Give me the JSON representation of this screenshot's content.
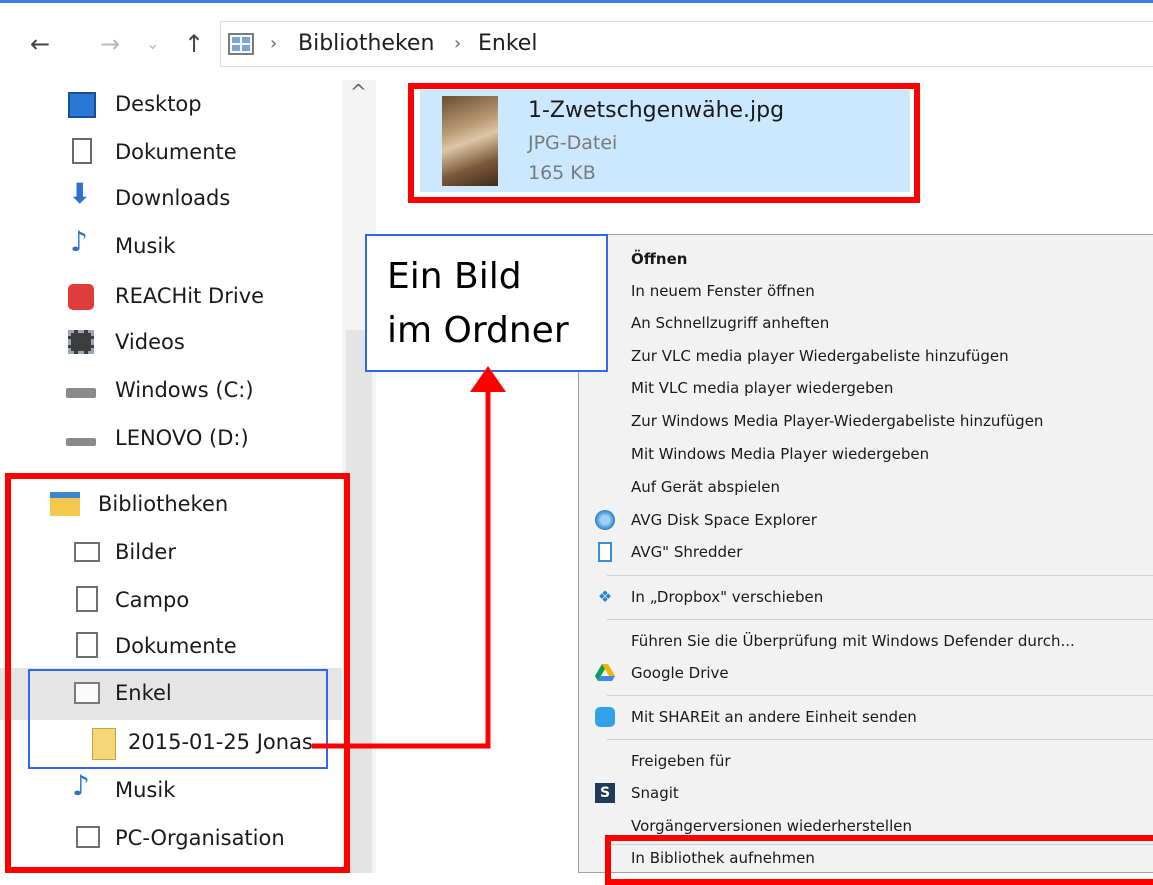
{
  "breadcrumb": {
    "items": [
      "Bibliotheken",
      "Enkel"
    ]
  },
  "nav": {
    "items": [
      {
        "label": "Desktop",
        "icon": "desktop-icon"
      },
      {
        "label": "Dokumente",
        "icon": "document-icon"
      },
      {
        "label": "Downloads",
        "icon": "download-arrow-icon"
      },
      {
        "label": "Musik",
        "icon": "music-note-icon"
      },
      {
        "label": "REACHit Drive",
        "icon": "reachit-icon"
      },
      {
        "label": "Videos",
        "icon": "film-icon"
      },
      {
        "label": "Windows (C:)",
        "icon": "drive-c-icon"
      },
      {
        "label": "LENOVO (D:)",
        "icon": "drive-d-icon"
      },
      {
        "label": "Bibliotheken",
        "icon": "libraries-icon"
      },
      {
        "label": "Bilder",
        "icon": "pictures-library-icon"
      },
      {
        "label": "Campo",
        "icon": "library-icon"
      },
      {
        "label": "Dokumente",
        "icon": "documents-library-icon"
      },
      {
        "label": "Enkel",
        "icon": "library-grid-icon"
      },
      {
        "label": "2015-01-25 Jonas",
        "icon": "folder-icon"
      },
      {
        "label": "Musik",
        "icon": "music-note-icon"
      },
      {
        "label": "PC-Organisation",
        "icon": "library-icon"
      }
    ]
  },
  "file": {
    "name": "1-Zwetschgenwähe.jpg",
    "type": "JPG-Datei",
    "size": "165 KB"
  },
  "context_menu": {
    "items": [
      {
        "label": "Öffnen",
        "bold": true
      },
      {
        "label": "In neuem Fenster öffnen"
      },
      {
        "label": "An Schnellzugriff anheften"
      },
      {
        "label": "Zur VLC media player Wiedergabeliste hinzufügen"
      },
      {
        "label": "Mit VLC media player wiedergeben"
      },
      {
        "label": "Zur Windows Media Player-Wiedergabeliste hinzufügen"
      },
      {
        "label": "Mit Windows Media Player wiedergeben"
      },
      {
        "label": "Auf Gerät abspielen"
      },
      {
        "label": "AVG Disk Space Explorer",
        "icon": "avg-disk-icon"
      },
      {
        "label": "AVG\" Shredder",
        "icon": "shredder-icon"
      },
      {
        "label": "In „Dropbox\" verschieben",
        "icon": "dropbox-icon"
      },
      {
        "label": "Führen Sie die Überprüfung mit Windows Defender durch...",
        "icon": ""
      },
      {
        "label": "Google Drive",
        "icon": "google-drive-icon"
      },
      {
        "label": "Mit SHAREit an andere Einheit senden",
        "icon": "shareit-icon"
      },
      {
        "label": "Freigeben für"
      },
      {
        "label": "Snagit",
        "icon": "snagit-icon"
      },
      {
        "label": "Vorgängerversionen wiederherstellen"
      },
      {
        "label": "In Bibliothek aufnehmen"
      }
    ]
  },
  "callout": {
    "line1": "Ein Bild",
    "line2": "im Ordner"
  },
  "colors": {
    "highlight": "#ff0000",
    "annotation_blue": "#3366ee",
    "selection": "#cce8ff"
  }
}
